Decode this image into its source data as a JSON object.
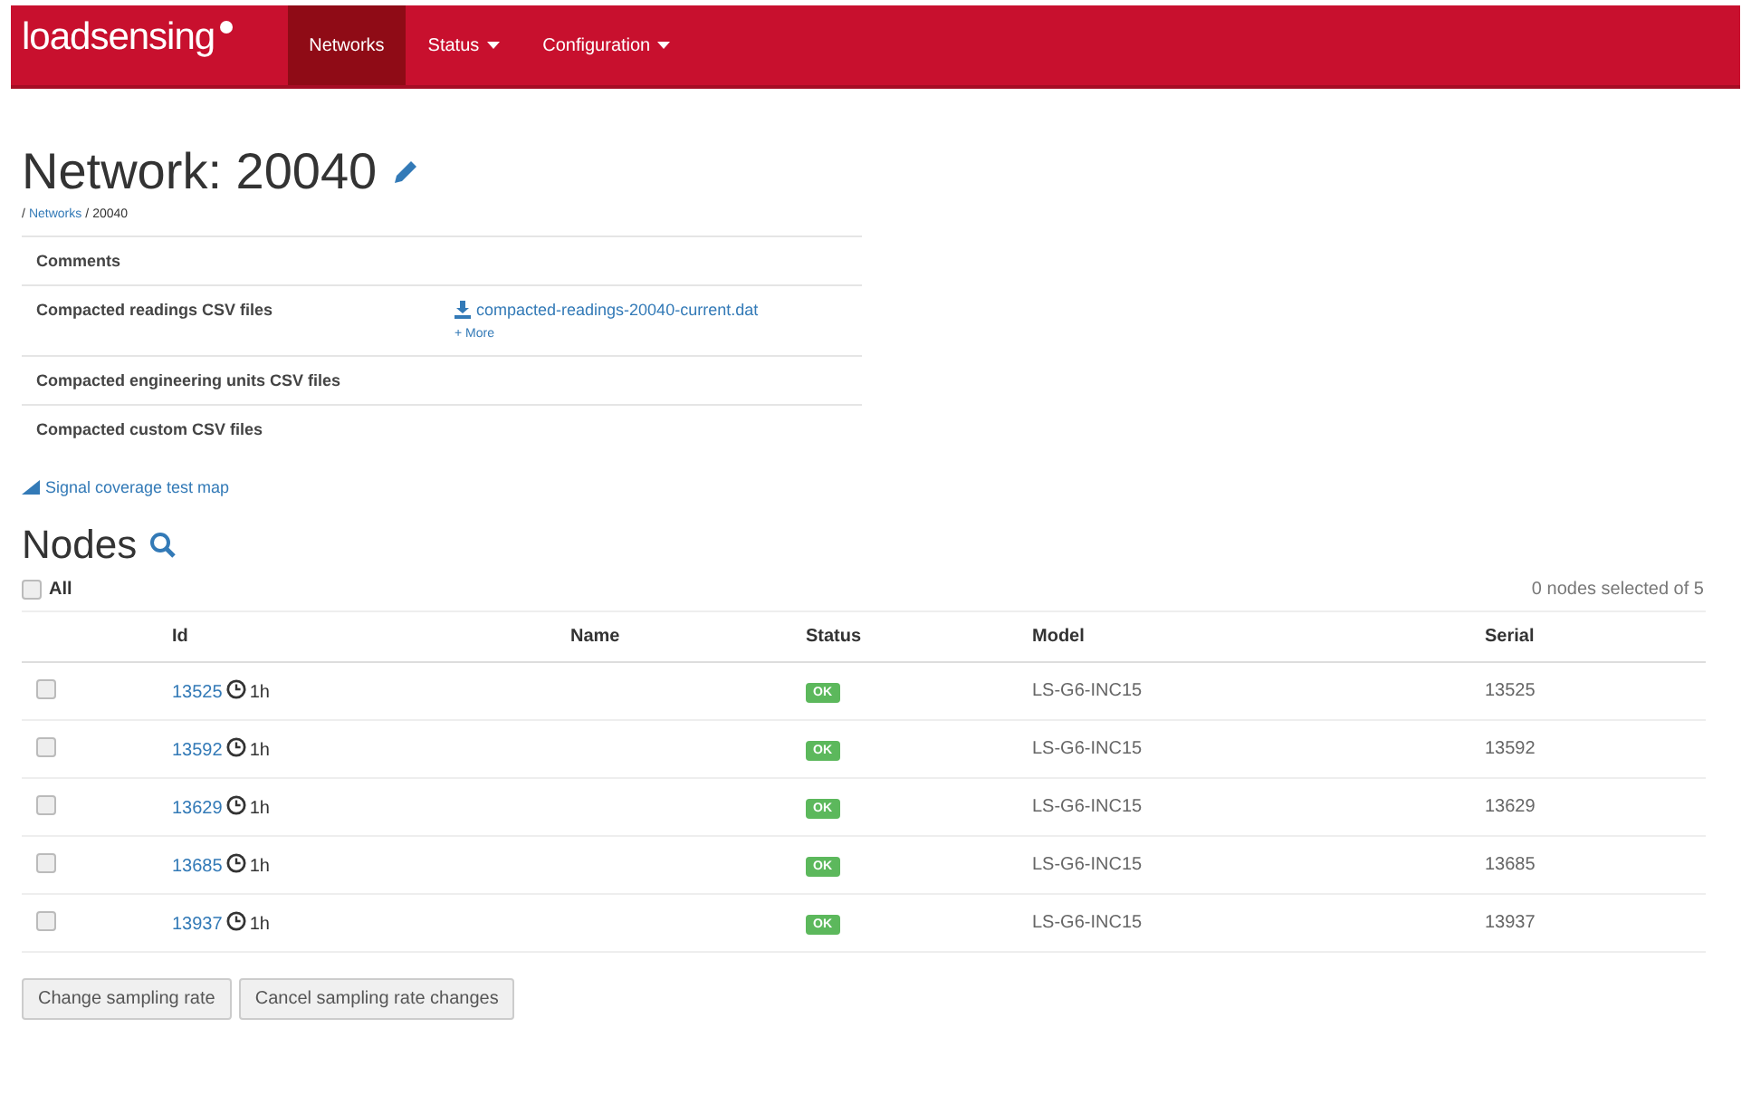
{
  "navbar": {
    "logo": "loadsensing",
    "items": [
      {
        "label": "Networks",
        "selected": true,
        "dropdown": false
      },
      {
        "label": "Status",
        "selected": false,
        "dropdown": true
      },
      {
        "label": "Configuration",
        "selected": false,
        "dropdown": true
      }
    ]
  },
  "title": "Network: 20040",
  "breadcrumb": {
    "separator": "/",
    "items": [
      "Networks",
      "20040"
    ]
  },
  "files": [
    {
      "label": "Comments"
    },
    {
      "label": "Compacted readings CSV files",
      "link": "compacted-readings-20040-current.dat",
      "more": "+ More"
    },
    {
      "label": "Compacted engineering units CSV files"
    },
    {
      "label": "Compacted custom CSV files"
    }
  ],
  "map_link": "Signal coverage test map",
  "nodes": {
    "title": "Nodes",
    "select_all": {
      "label": "All",
      "checked": false
    },
    "selection_count": "0 nodes selected of 5",
    "columns": [
      "Id",
      "Name",
      "Status",
      "Model",
      "Serial"
    ],
    "rows": [
      {
        "checked": false,
        "id": "13525",
        "age": "1h",
        "status": "OK",
        "model": "LS-G6-INC15",
        "serial": "13525"
      },
      {
        "checked": false,
        "id": "13592",
        "age": "1h",
        "status": "OK",
        "model": "LS-G6-INC15",
        "serial": "13592"
      },
      {
        "checked": false,
        "id": "13629",
        "age": "1h",
        "status": "OK",
        "model": "LS-G6-INC15",
        "serial": "13629"
      },
      {
        "checked": false,
        "id": "13685",
        "age": "1h",
        "status": "OK",
        "model": "LS-G6-INC15",
        "serial": "13685"
      },
      {
        "checked": false,
        "id": "13937",
        "age": "1h",
        "status": "OK",
        "model": "LS-G6-INC15",
        "serial": "13937"
      }
    ]
  },
  "buttons": [
    "Change sampling rate",
    "Cancel sampling rate changes"
  ]
}
